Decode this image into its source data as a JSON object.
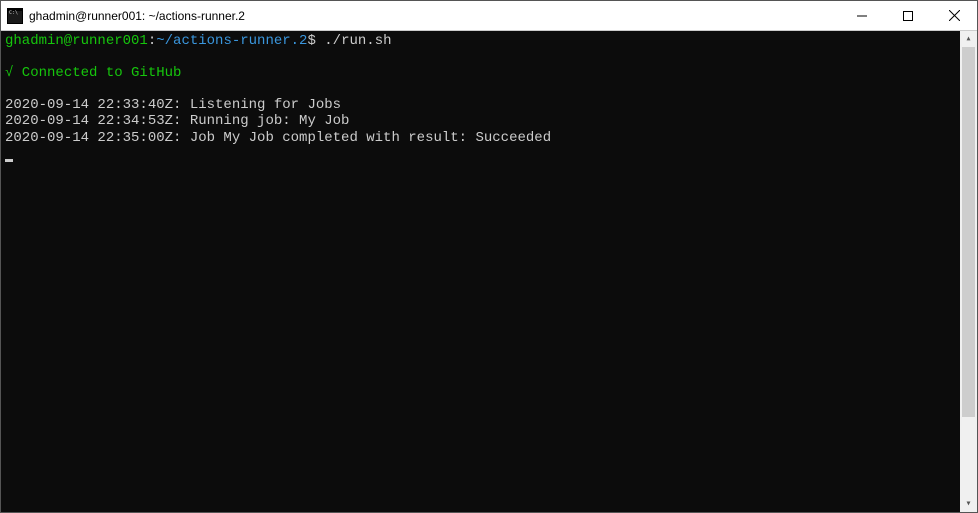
{
  "window": {
    "title": "ghadmin@runner001: ~/actions-runner.2"
  },
  "prompt": {
    "user_host": "ghadmin@runner001",
    "sep1": ":",
    "path": "~/actions-runner.2",
    "sigil": "$",
    "command": "./run.sh"
  },
  "status": {
    "check": "√",
    "connected": " Connected to GitHub"
  },
  "log": [
    "2020-09-14 22:33:40Z: Listening for Jobs",
    "2020-09-14 22:34:53Z: Running job: My Job",
    "2020-09-14 22:35:00Z: Job My Job completed with result: Succeeded"
  ]
}
